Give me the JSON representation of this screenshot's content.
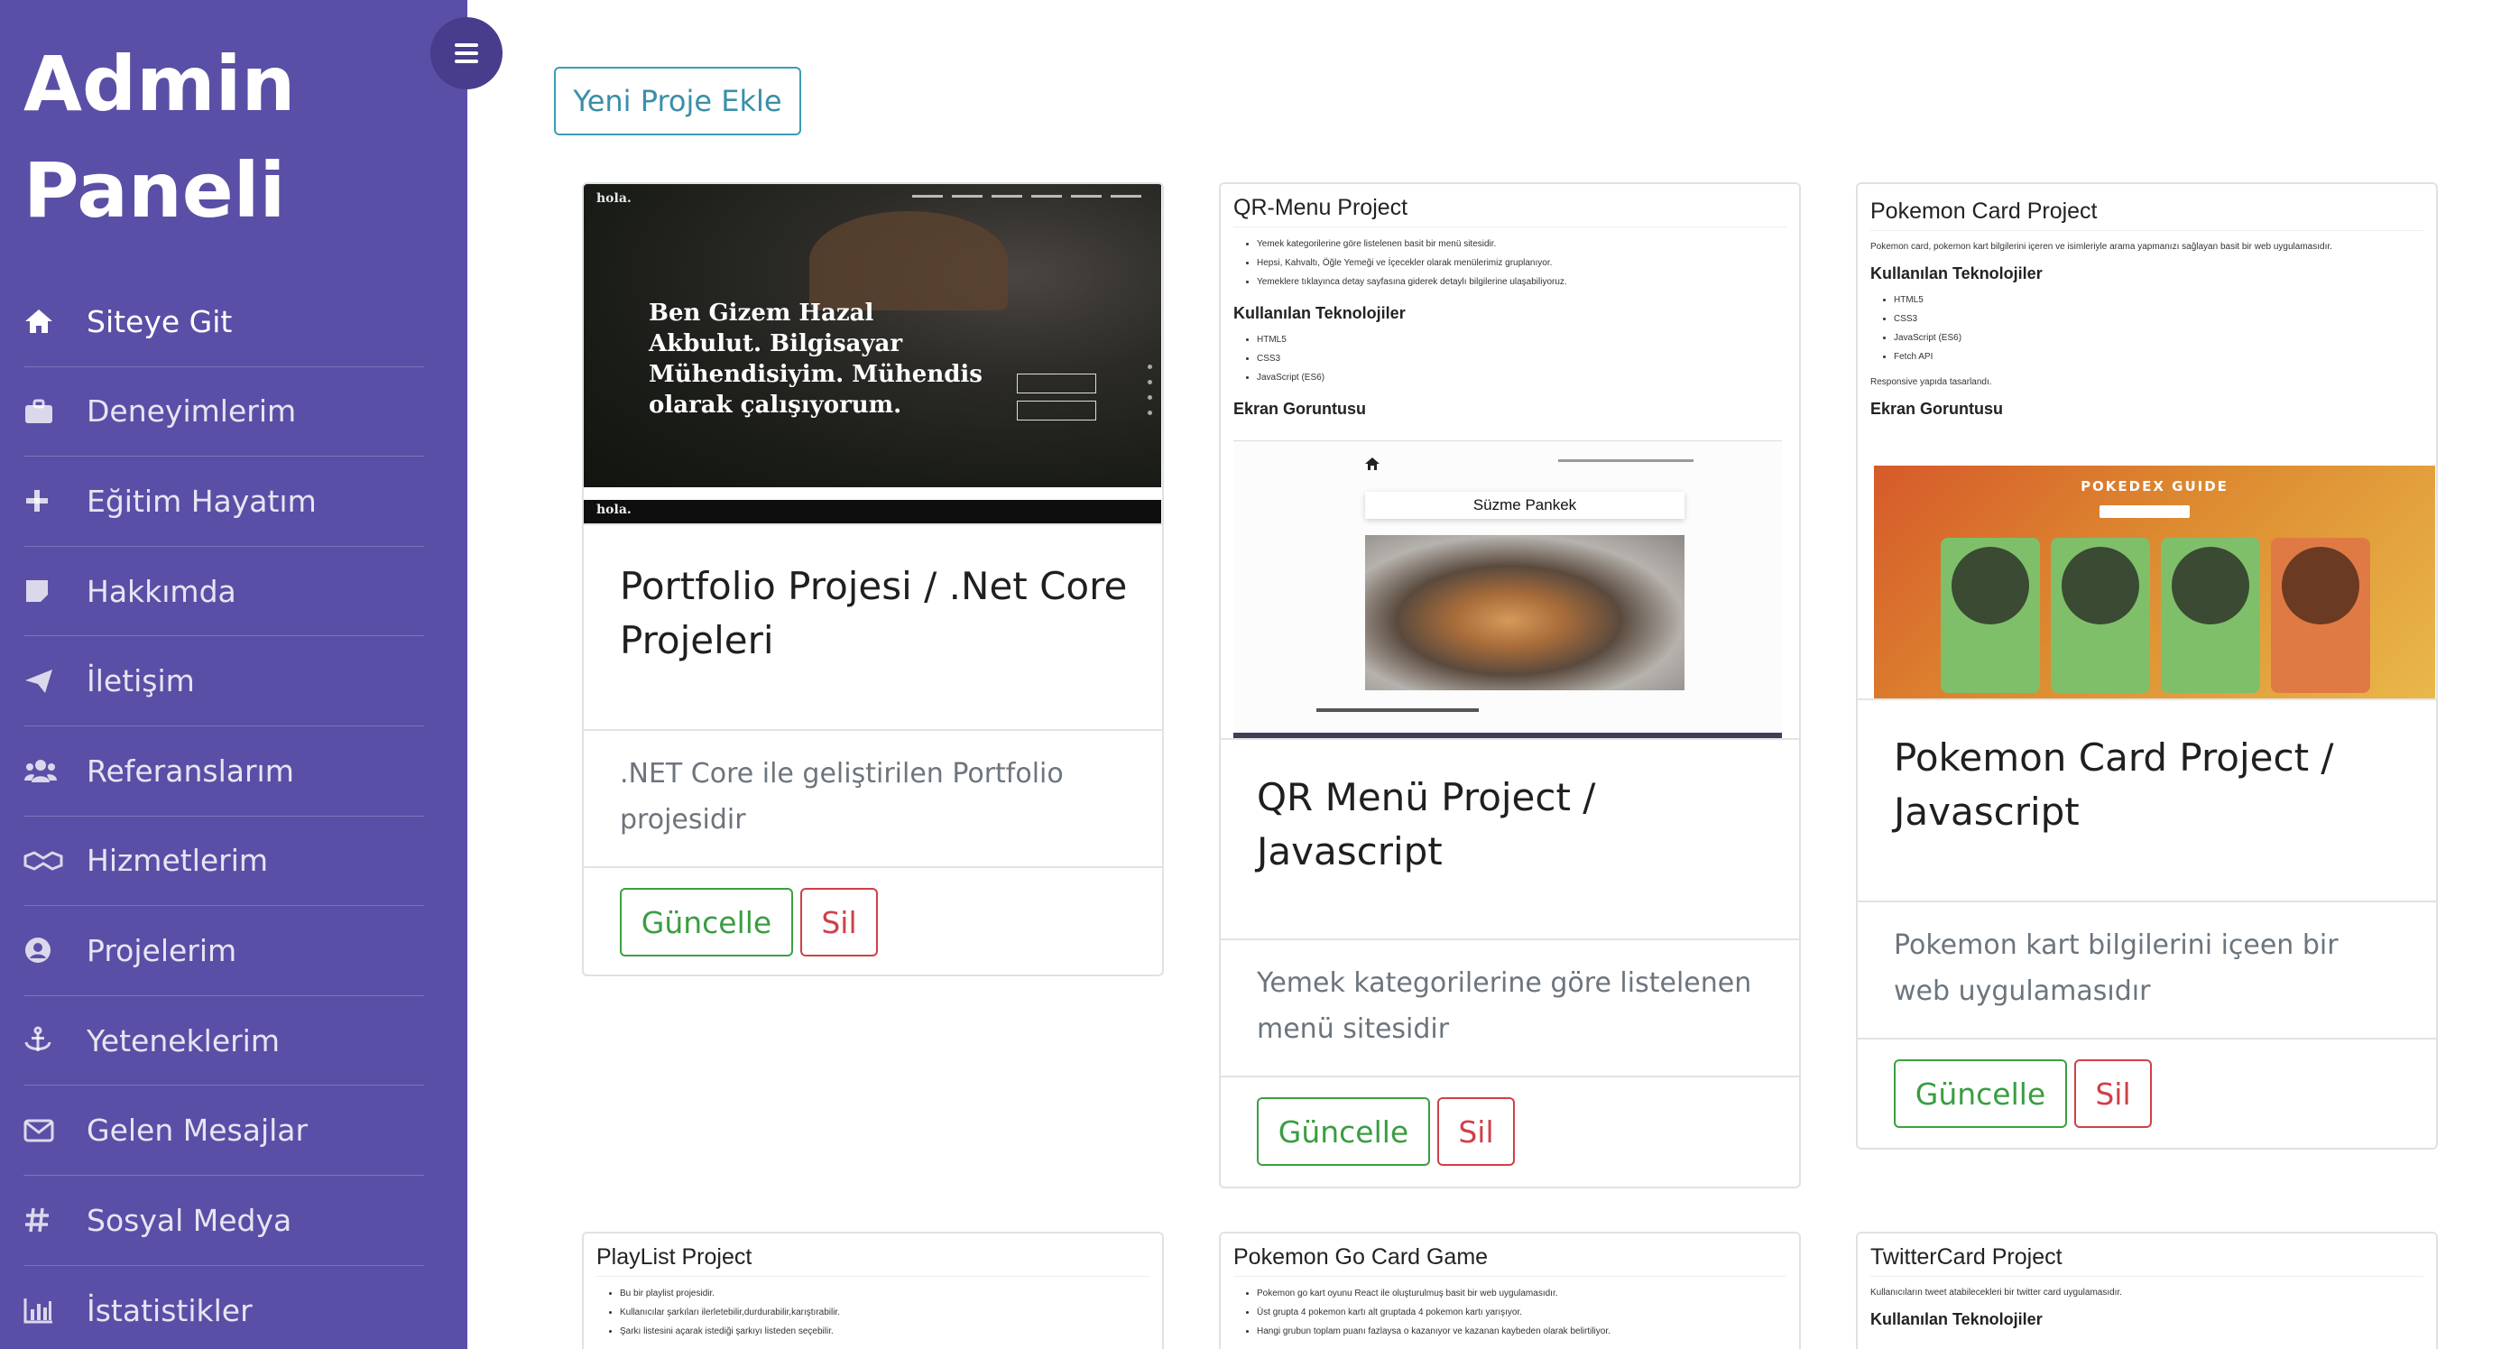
{
  "sidebar": {
    "brand_line1": "Admin",
    "brand_line2": "Paneli",
    "items": [
      {
        "label": "Siteye Git",
        "icon": "home-icon"
      },
      {
        "label": "Deneyimlerim",
        "icon": "briefcase-icon"
      },
      {
        "label": "Eğitim Hayatım",
        "icon": "plus-icon"
      },
      {
        "label": "Hakkımda",
        "icon": "note-icon"
      },
      {
        "label": "İletişim",
        "icon": "paper-plane-icon"
      },
      {
        "label": "Referanslarım",
        "icon": "users-icon"
      },
      {
        "label": "Hizmetlerim",
        "icon": "handshake-icon"
      },
      {
        "label": "Projelerim",
        "icon": "user-circle-icon"
      },
      {
        "label": "Yeteneklerim",
        "icon": "anchor-icon"
      },
      {
        "label": "Gelen Mesajlar",
        "icon": "envelope-icon"
      },
      {
        "label": "Sosyal Medya",
        "icon": "hashtag-icon"
      },
      {
        "label": "İstatistikler",
        "icon": "bar-chart-icon"
      }
    ]
  },
  "toolbar": {
    "add_label": "Yeni Proje Ekle"
  },
  "buttons": {
    "update": "Güncelle",
    "delete": "Sil"
  },
  "colors": {
    "sidebar_bg": "#5a4fa6",
    "accent": "#3c9bb5",
    "success": "#3aa040",
    "danger": "#d04048"
  },
  "cards": [
    {
      "title": "Portfolio Projesi / .Net Core Projeleri",
      "description": ".NET Core ile geliştirilen Portfolio projesidir",
      "preview": {
        "logo": "hola.",
        "headline": "Ben Gizem Hazal Akbulut. Bilgisayar Mühendisiyim. Mühendis olarak çalışıyorum."
      }
    },
    {
      "title": "QR Menü Project / Javascript",
      "description": "Yemek kategorilerine göre listelenen menü sitesidir",
      "preview": {
        "heading": "QR-Menu Project",
        "bullets": [
          "Yemek kategorilerine göre listelenen basit bir menü sitesidir.",
          "Hepsi, Kahvaltı, Öğle Yemeği ve İçecekler olarak menülerimiz gruplanıyor.",
          "Yemeklere tıklayınca detay sayfasına giderek detaylı bilgilerine ulaşabiliyoruz."
        ],
        "tech_heading": "Kullanılan Teknolojiler",
        "tech": [
          "HTML5",
          "CSS3",
          "JavaScript (ES6)"
        ],
        "shot_heading": "Ekran Goruntusu",
        "shot_tag": "Süzme Pankek"
      }
    },
    {
      "title": "Pokemon Card Project / Javascript",
      "description": "Pokemon kart bilgilerini içeen bir web uygulamasıdır",
      "preview": {
        "heading": "Pokemon Card Project",
        "intro": "Pokemon card, pokemon kart bilgilerini içeren ve isimleriyle arama yapmanızı sağlayan basit bir web uygulamasıdır.",
        "tech_heading": "Kullanılan Teknolojiler",
        "tech": [
          "HTML5",
          "CSS3",
          "JavaScript (ES6)",
          "Fetch API"
        ],
        "note": "Responsive yapıda tasarlandı.",
        "shot_heading": "Ekran Goruntusu",
        "shot_title": "POKEDEX GUIDE"
      }
    },
    {
      "preview": {
        "heading": "PlayList Project",
        "bullets": [
          "Bu bir playlist projesidir.",
          "Kullanıcılar şarkıları ilerletebilir,durdurabilir,karıştırabilir.",
          "Şarkı listesini açarak istediği şarkıyı listeden seçebilir."
        ]
      }
    },
    {
      "preview": {
        "heading": "Pokemon Go Card Game",
        "bullets": [
          "Pokemon go kart oyunu React ile oluşturulmuş basit bir web uygulamasıdır.",
          "Üst grupta 4 pokemon kartı alt gruptada 4 pokemon kartı yarışıyor.",
          "Hangi grubun toplam puanı fazlaysa o kazanıyor ve kazanan kaybeden olarak belirtiliyor."
        ]
      }
    },
    {
      "preview": {
        "heading": "TwitterCard Project",
        "intro": "Kullanıcıların tweet atabilecekleri bir twitter card uygulamasıdır.",
        "tech_heading": "Kullanılan Teknolojiler"
      }
    }
  ]
}
